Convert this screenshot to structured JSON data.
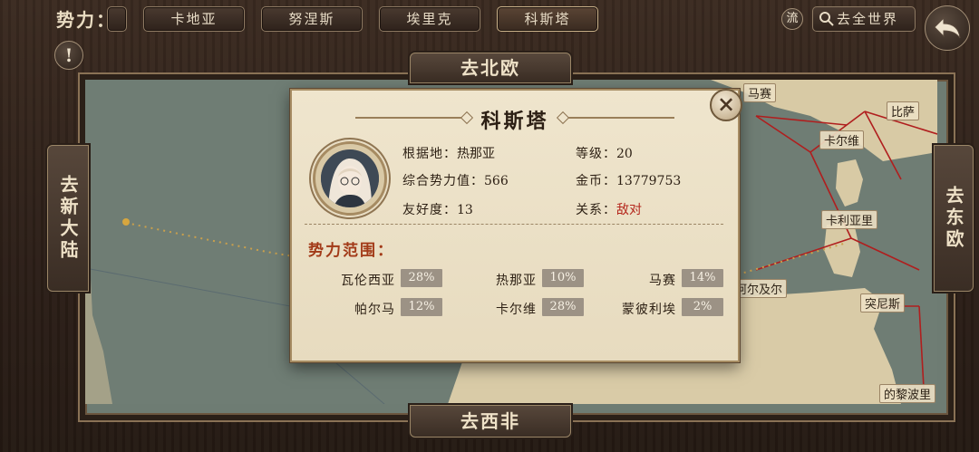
{
  "header": {
    "faction_label": "势力：",
    "tabs": [
      "",
      "卡地亚",
      "努涅斯",
      "埃里克",
      "科斯塔"
    ],
    "flow_label": "流",
    "search_label": "去全世界"
  },
  "map": {
    "nav": {
      "north": "去北欧",
      "south": "去西非",
      "west": "去新大陆",
      "east": "去东欧"
    },
    "cities": [
      "马赛",
      "比萨",
      "卡尔维",
      "卡利亚里",
      "阿尔及尔",
      "突尼斯",
      "的黎波里"
    ]
  },
  "popup": {
    "title": "科斯塔",
    "base_label": "根据地：",
    "base_value": "热那亚",
    "power_label": "综合势力值：",
    "power_value": "566",
    "friendship_label": "友好度：",
    "friendship_value": "13",
    "level_label": "等级：",
    "level_value": "20",
    "gold_label": "金币：",
    "gold_value": "13779753",
    "relation_label": "关系：",
    "relation_value": "敌对",
    "range_title": "势力范围：",
    "territories": [
      {
        "name": "瓦伦西亚",
        "pct": "28%"
      },
      {
        "name": "热那亚",
        "pct": "10%"
      },
      {
        "name": "马赛",
        "pct": "14%"
      },
      {
        "name": "帕尔马",
        "pct": "12%"
      },
      {
        "name": "卡尔维",
        "pct": "28%"
      },
      {
        "name": "蒙彼利埃",
        "pct": "2%"
      }
    ]
  },
  "colors": {
    "hostile": "#b4261c",
    "accent_title": "#a23a18"
  }
}
